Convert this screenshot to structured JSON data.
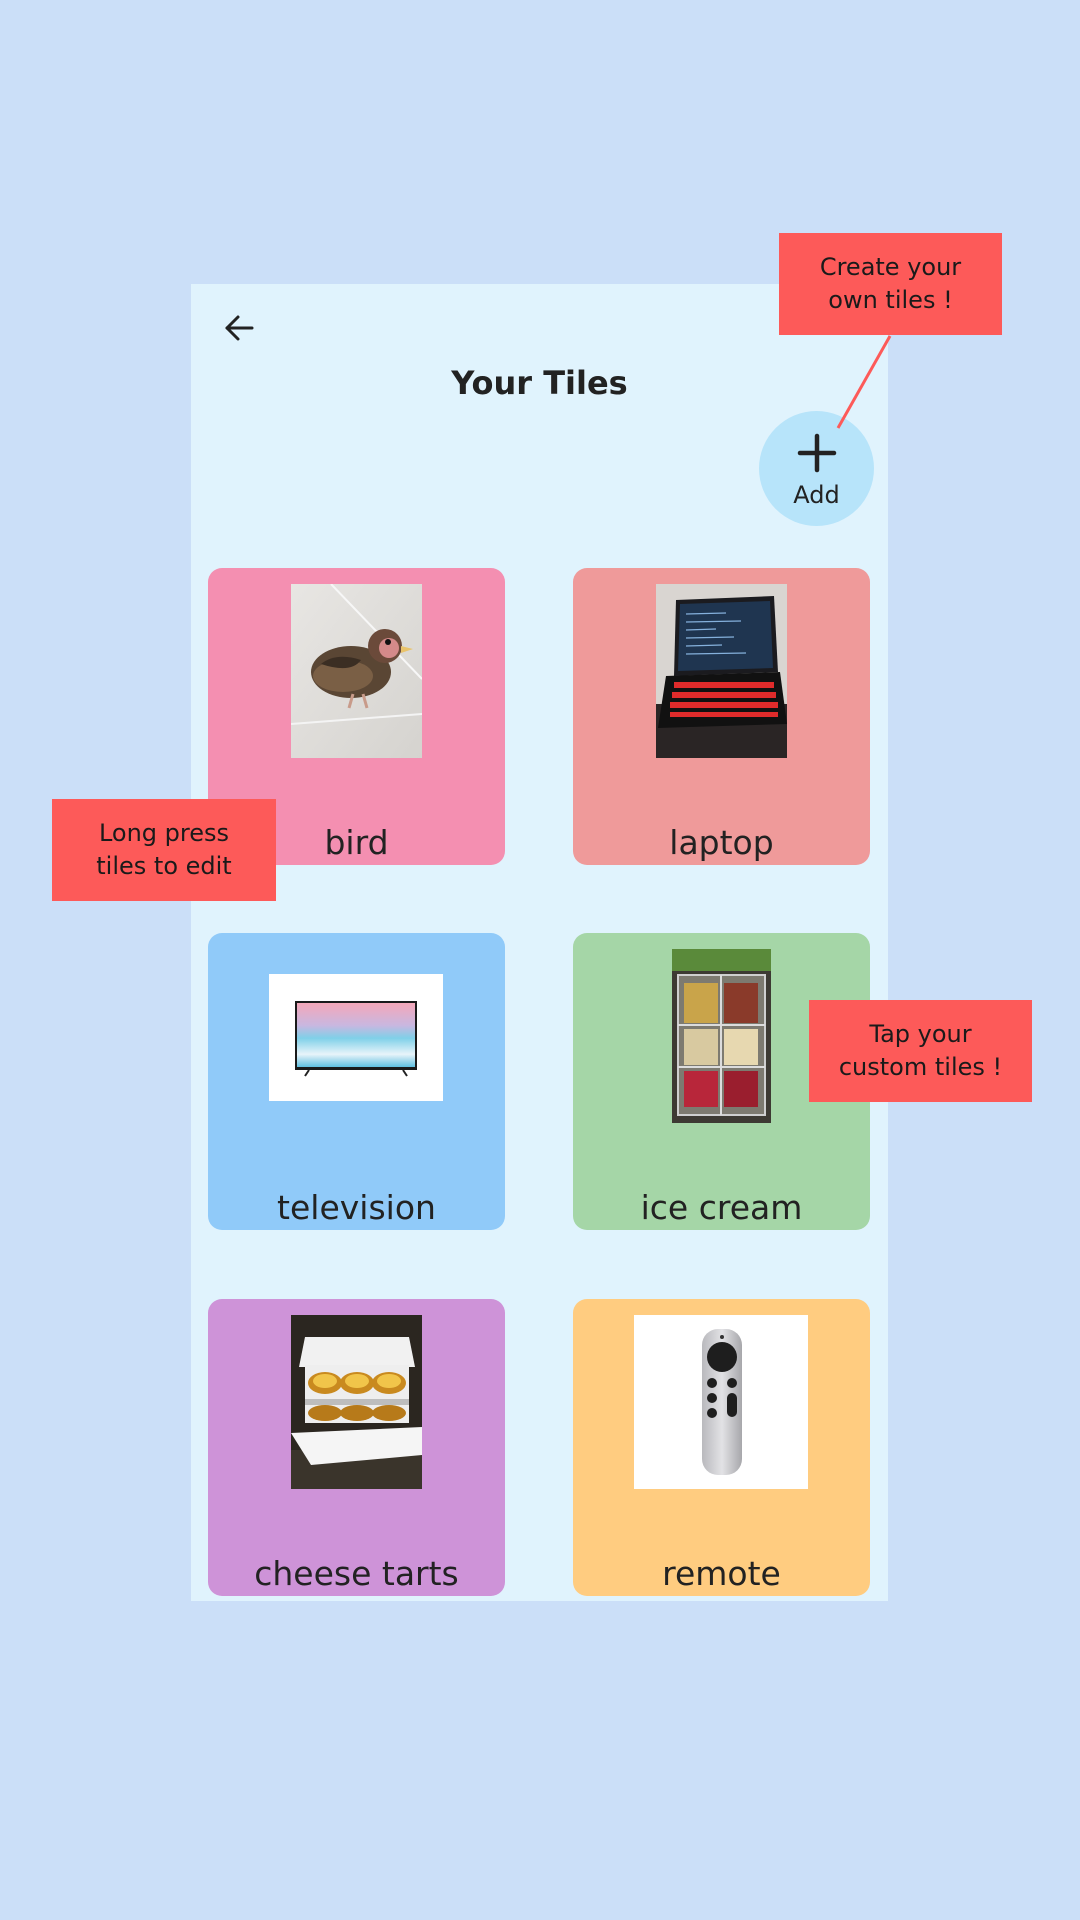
{
  "screen": {
    "title": "Your Tiles",
    "back_icon": "arrow-left-icon",
    "add_button": {
      "label": "Add",
      "icon": "plus-icon"
    }
  },
  "tiles": [
    {
      "label": "bird",
      "color": "#f48fb1",
      "image": "bird-photo"
    },
    {
      "label": "laptop",
      "color": "#ef9a9a",
      "image": "laptop-photo"
    },
    {
      "label": "television",
      "color": "#90caf9",
      "image": "television-photo"
    },
    {
      "label": "ice cream",
      "color": "#a5d6a7",
      "image": "ice-cream-photo"
    },
    {
      "label": "cheese tarts",
      "color": "#ce93d8",
      "image": "cheese-tarts-photo"
    },
    {
      "label": "remote",
      "color": "#ffcc80",
      "image": "remote-photo"
    }
  ],
  "callouts": {
    "create": "Create your\nown tiles !",
    "long_press": "Long press\ntiles to edit",
    "tap": "Tap your\ncustom tiles !"
  },
  "colors": {
    "page_background": "#cbdff8",
    "screen_background": "#e0f3fd",
    "add_button": "#b7e4fa",
    "callout": "#fd5a59"
  }
}
